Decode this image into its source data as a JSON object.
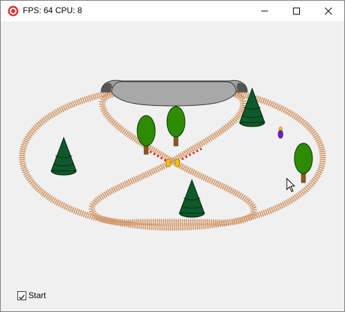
{
  "window": {
    "title": "FPS: 64 CPU: 8",
    "minimize_icon": "minimize-icon",
    "maximize_icon": "maximize-icon",
    "close_icon": "close-icon"
  },
  "controls": {
    "start_label": "Start",
    "start_checked": true
  },
  "scene": {
    "background": "#f0f0f0",
    "rail_color": "#e8a872",
    "tie_color": "#c08a60",
    "tunnel_color": "#a0a0a0",
    "pine_color": "#0e5a2b",
    "tree_color": "#2e8b00",
    "trunk_color": "#8b5a14",
    "barrier_color": "#e02020",
    "signal_color": "#f5c000",
    "figure_color": "#7020c0"
  }
}
